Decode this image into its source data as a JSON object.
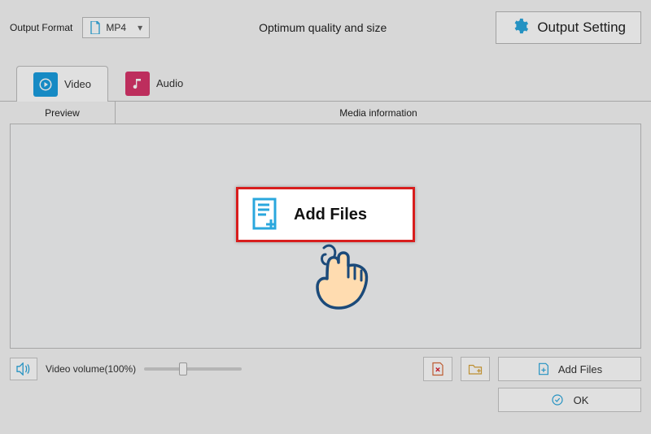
{
  "topbar": {
    "output_format_label": "Output Format",
    "selected_format": "MP4",
    "quality_text": "Optimum quality and size",
    "settings_label": "Output Setting"
  },
  "tabs": {
    "video_label": "Video",
    "audio_label": "Audio"
  },
  "columns": {
    "preview": "Preview",
    "media_info": "Media information"
  },
  "bottom": {
    "volume_label": "Video volume(100%)",
    "add_files_label": "Add Files",
    "ok_label": "OK"
  },
  "popup": {
    "label": "Add Files"
  },
  "colors": {
    "accent": "#2aa7dd",
    "highlight_border": "#d81e1e",
    "audio_bg": "#d8356a"
  }
}
